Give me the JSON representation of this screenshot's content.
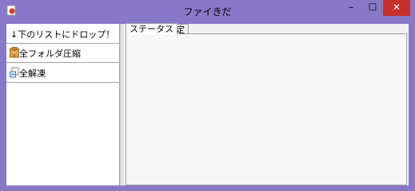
{
  "window": {
    "title": "ファイきだ",
    "icons": {
      "app": "app-icon",
      "minimize": "minimize-icon",
      "maximize": "maximize-icon",
      "close": "close-icon"
    },
    "controls": {
      "minimize": "–",
      "maximize": "☐",
      "close": "✕"
    },
    "colors": {
      "frame": "#8878c8",
      "close_button": "#c7312a"
    }
  },
  "left_panel": {
    "items": [
      {
        "label": "↓下のリストにドロップ！",
        "icon": ""
      },
      {
        "label": "全フォルダ圧縮",
        "icon": "archive-icon"
      },
      {
        "label": "全解凍",
        "icon": "extract-icon"
      }
    ]
  },
  "tabs": [
    {
      "label": "ステータス",
      "active": true
    },
    {
      "label": "設定",
      "active": false
    }
  ]
}
